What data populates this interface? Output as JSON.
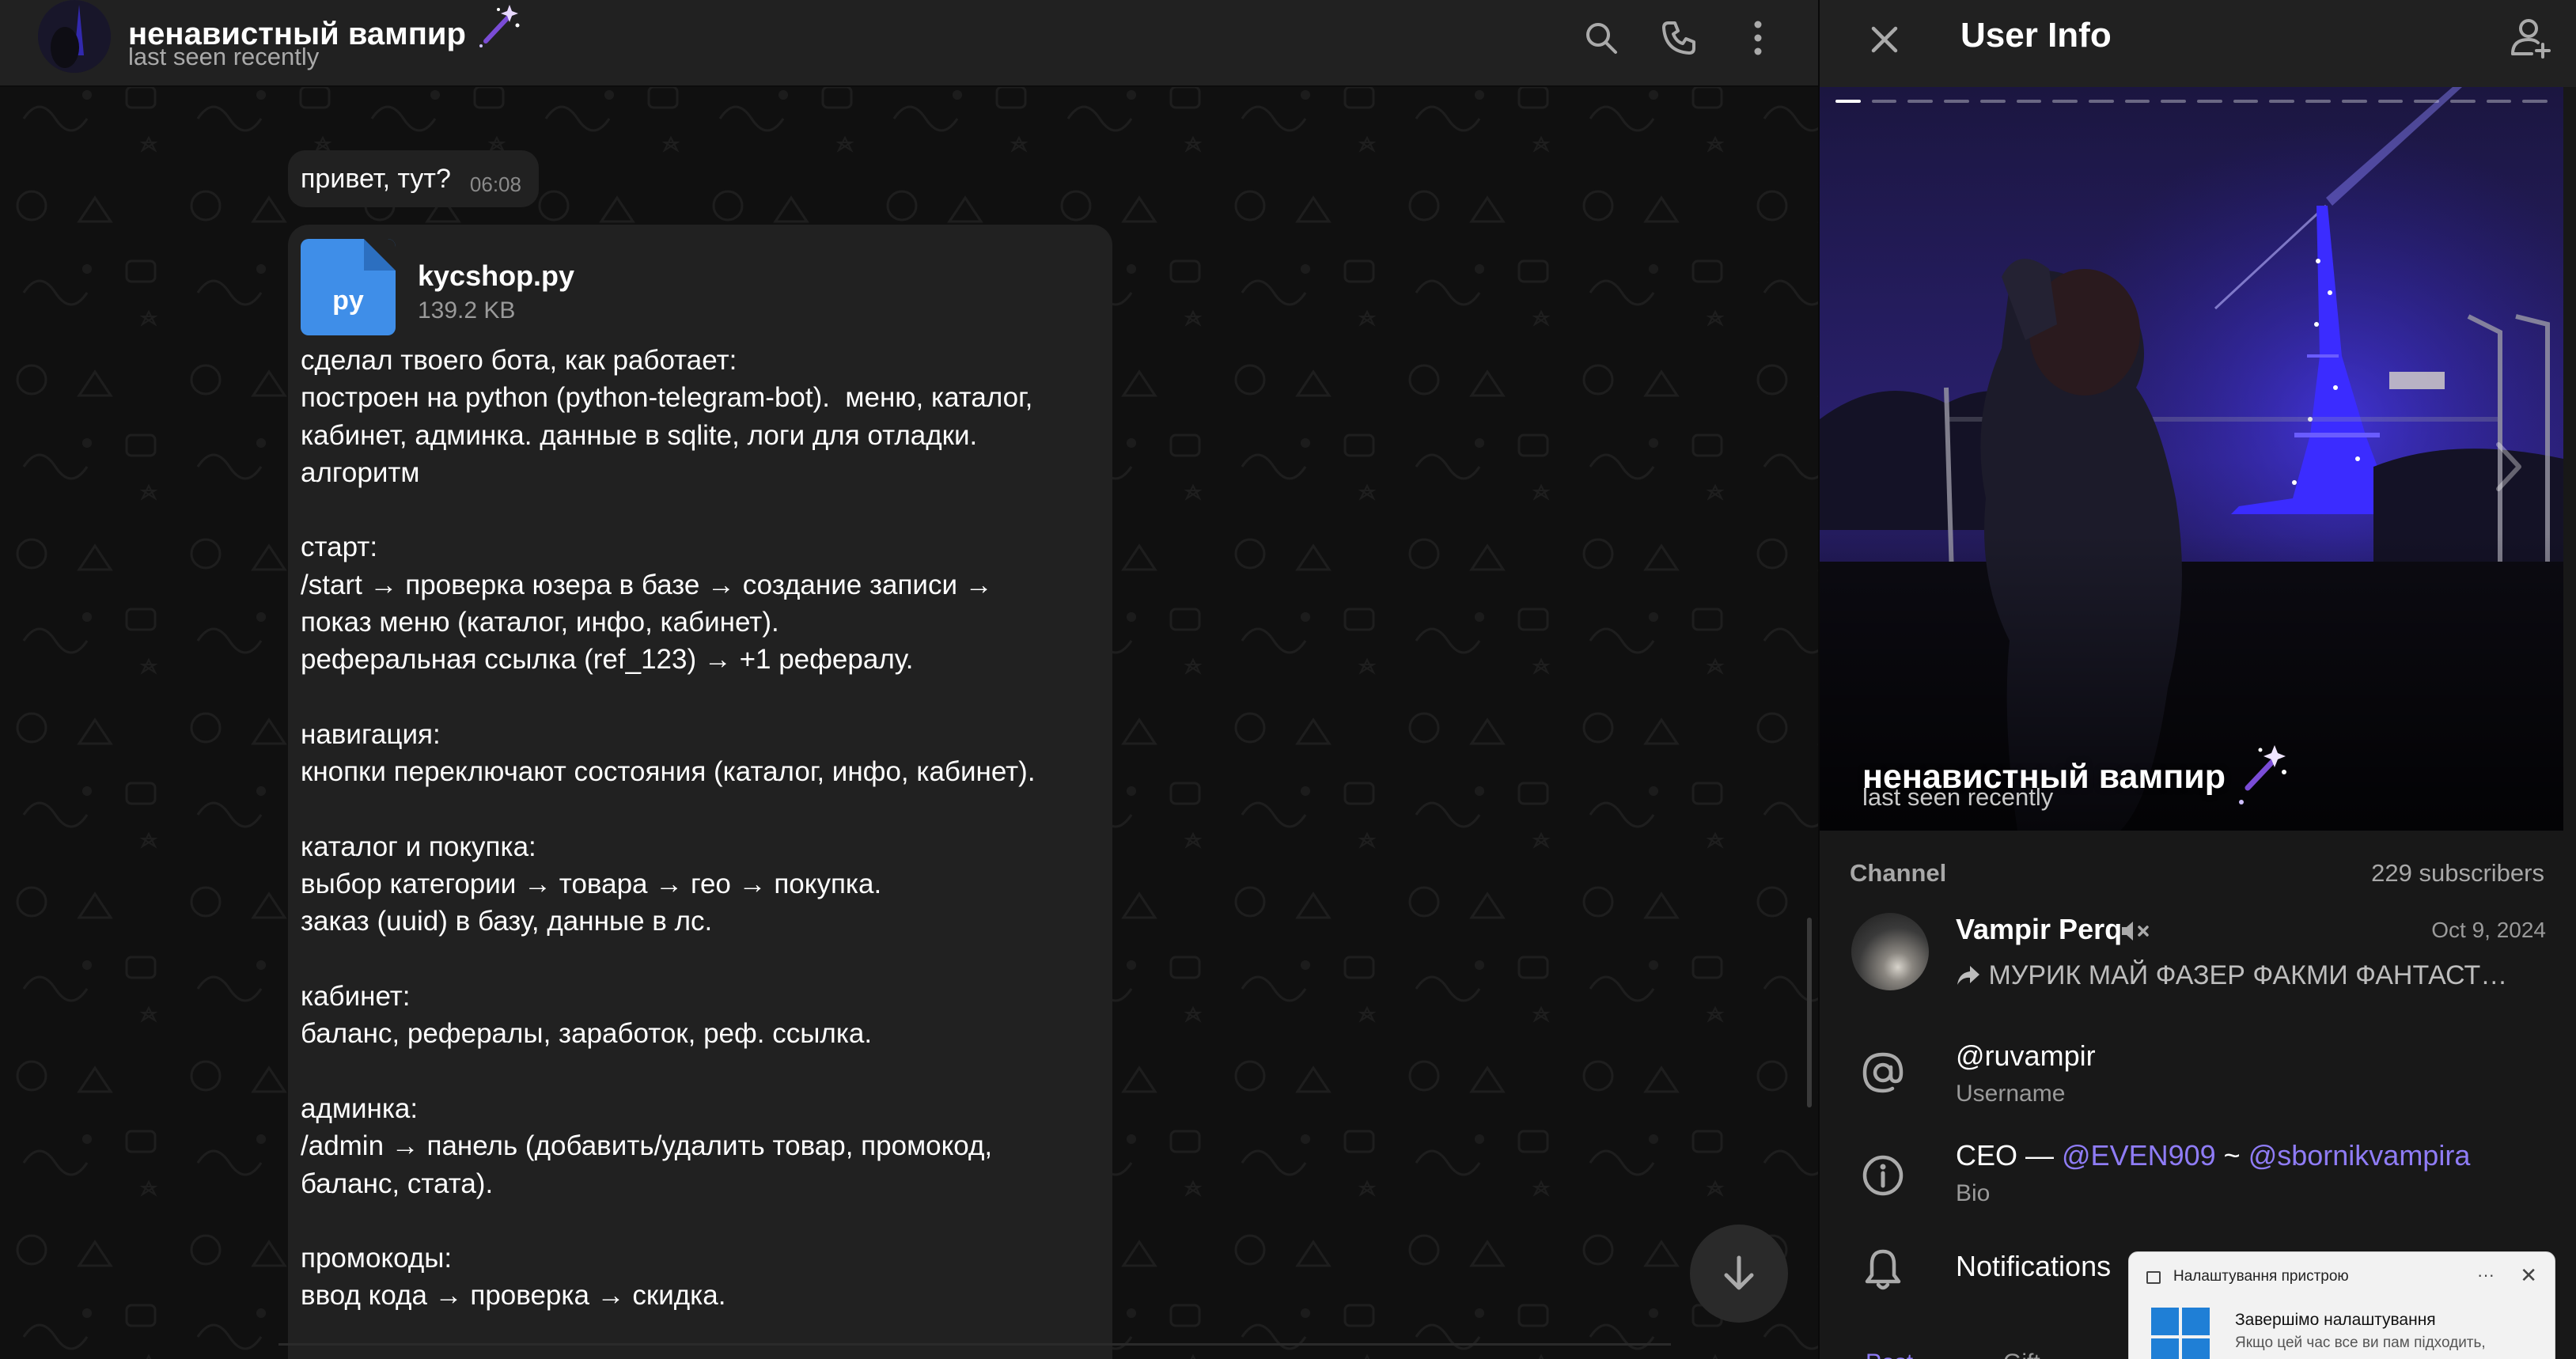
{
  "chat": {
    "title": "ненавистный вампир",
    "status": "last seen recently",
    "messages": {
      "greeting": {
        "text": "привет, тут?",
        "time": "06:08"
      },
      "file": {
        "ext": "py",
        "name": "kycshop.py",
        "size": "139.2 KB"
      },
      "body": "сделал твоего бота, как работает:\nпостроен на python (python-telegram-bot).  меню, каталог,\nкабинет, админка. данные в sqlite, логи для отладки.\nалгоритм\n\nстарт:\n/start → проверка юзера в базе → создание записи →\nпоказ меню (каталог, инфо, кабинет).\nреферальная ссылка (ref_123) → +1 рефералу.\n\nнавигация:\nкнопки переключают состояния (каталог, инфо, кабинет).\n\nкаталог и покупка:\nвыбор категории → товара → гео → покупка.\nзаказ (uuid) в базу, данные в лс.\n\nкабинет:\nбаланс, рефералы, заработок, реф. ссылка.\n\nадминка:\n/admin → панель (добавить/удалить товар, промокод,\nбаланс, стата).\n\nпромокоды:\nввод кода → проверка → скидка."
    },
    "icons": {
      "search": "search-icon",
      "call": "phone-icon",
      "menu": "more-vertical-icon",
      "scroll": "arrow-down-icon",
      "emoji": "sparkles-icon"
    }
  },
  "info": {
    "title": "User Info",
    "profile_name": "ненавистный вампир",
    "profile_status": "last seen recently",
    "photo_count": 20,
    "channel": {
      "label": "Channel",
      "subscribers": "229 subscribers",
      "name": "Vampir Perq",
      "date": "Oct 9, 2024",
      "last_post": "МУРИК МАЙ ФАЗЕР ФАКМИ ФАНТАСТ…"
    },
    "username": {
      "value": "@ruvampir",
      "label": "Username"
    },
    "bio": {
      "prefix": "CEO — ",
      "link1": "@EVEN909",
      "sep": " ~ ",
      "link2": "@sbornikvampira",
      "label": "Bio"
    },
    "notifications": "Notifications",
    "tabs_peek": [
      "Post",
      "Gift"
    ]
  },
  "toast": {
    "app": "Налаштування пристрою",
    "title": "Завершімо налаштування",
    "body": "Якщо цей час все ви пам підходить,"
  },
  "colors": {
    "accent": "#8f7cf6",
    "file_blue": "#3f8ee8",
    "eiffel_blue": "#3b2cff"
  }
}
